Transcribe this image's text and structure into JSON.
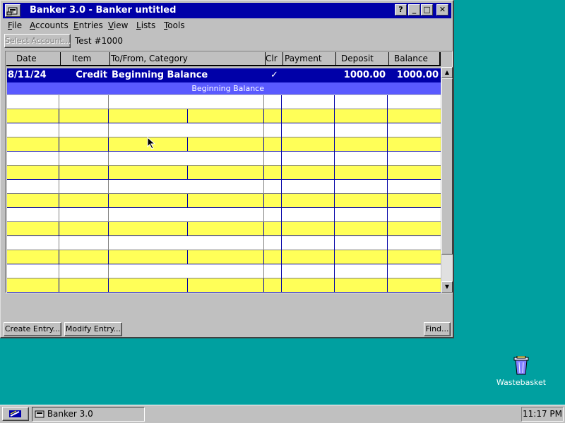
{
  "window": {
    "title": "Banker 3.0 - Banker untitled",
    "help_btn": "?",
    "minimize_btn": "_",
    "maximize_btn": "□",
    "close_btn": "✕"
  },
  "menu": [
    "File",
    "Accounts",
    "Entries",
    "View",
    "Lists",
    "Tools"
  ],
  "toolbar": {
    "select_account": "Select Account...",
    "account_name": "Test #1000"
  },
  "columns": [
    "Date",
    "Item",
    "To/From, Category",
    "Clr",
    "Payment",
    "Deposit",
    "Balance"
  ],
  "entry": {
    "date": "8/11/24",
    "item": "Credit",
    "to_from": "Beginning Balance",
    "clr": "✓",
    "payment": "",
    "deposit": "1000.00",
    "balance": "1000.00",
    "category": "Beginning Balance"
  },
  "buttons": {
    "create": "Create Entry...",
    "modify": "Modify Entry...",
    "find": "Find..."
  },
  "taskbar": {
    "app_label": "Banker 3.0",
    "clock": "11:17 PM"
  },
  "desktop": {
    "wastebasket": "Wastebasket"
  },
  "colors": {
    "title_bg": "#0000A8",
    "selected_row": "#0000A8",
    "selected_sub": "#5A5AFF",
    "yellow_row": "#FFFF58",
    "desktop": "#00A0A0"
  }
}
